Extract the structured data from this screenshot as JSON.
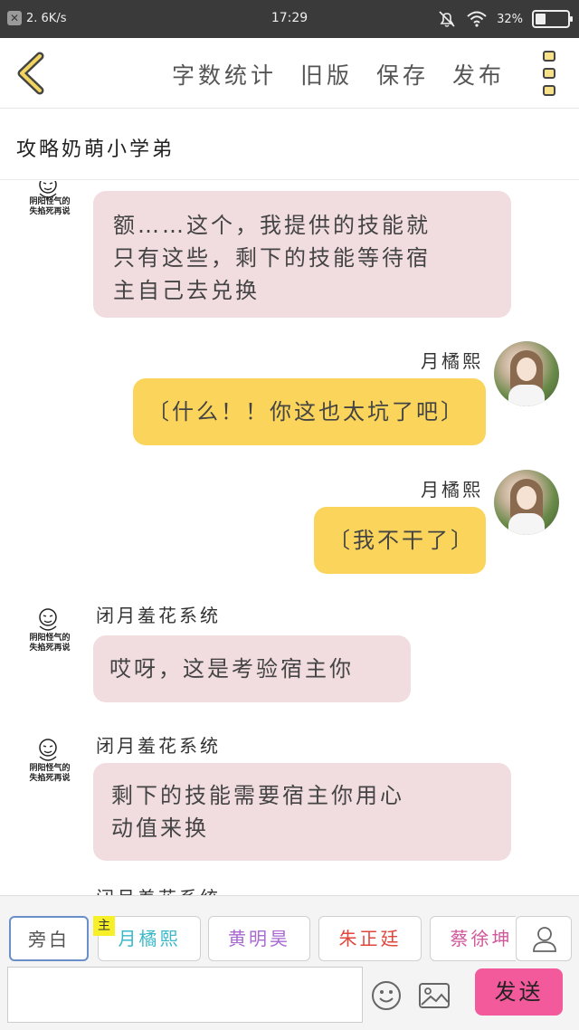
{
  "status_bar": {
    "speed": "2. 6K/s",
    "time": "17:29",
    "battery_percent": "32%",
    "battery_level": 0.32
  },
  "toolbar": {
    "back_icon": "chevron-left-icon",
    "actions": [
      "字数统计",
      "旧版",
      "保存",
      "发布"
    ],
    "menu_icon": "more-vertical-icon",
    "accent_color": "#e9c84a"
  },
  "story": {
    "title": "攻略奶萌小学弟"
  },
  "system_avatar_caption": [
    "阴阳怪气的",
    "失掐死再说"
  ],
  "messages": [
    {
      "sender": "",
      "side": "left",
      "text": [
        "额……这个，我提供的技能就",
        "只有这些，剩下的技能等待宿",
        "主自己去兑换"
      ]
    },
    {
      "sender": "月橘熙",
      "side": "right",
      "text": [
        "〔什么！！你这也太坑了吧〕"
      ]
    },
    {
      "sender": "月橘熙",
      "side": "right",
      "text": [
        "〔我不干了〕"
      ]
    },
    {
      "sender": "闭月羞花系统",
      "side": "left",
      "text": [
        "哎呀，这是考验宿主你"
      ]
    },
    {
      "sender": "闭月羞花系统",
      "side": "left",
      "text": [
        "剩下的技能需要宿主你用心",
        "动值来换"
      ]
    },
    {
      "sender": "闭月羞花系统",
      "side": "left",
      "text": []
    }
  ],
  "roles": [
    {
      "label": "旁白",
      "color": "#555555"
    },
    {
      "label": "月橘熙",
      "color": "#3bb8c8"
    },
    {
      "label": "黄明昊",
      "color": "#a86ad0"
    },
    {
      "label": "朱正廷",
      "color": "#e0463c"
    },
    {
      "label": "蔡徐坤",
      "color": "#d0589a"
    }
  ],
  "main_tag": "主",
  "input": {
    "placeholder": ""
  },
  "send_label": "发送",
  "colors": {
    "pink_bubble": "#f1dde0",
    "yellow_bubble": "#fbd55b",
    "send_button": "#f25a9b"
  }
}
